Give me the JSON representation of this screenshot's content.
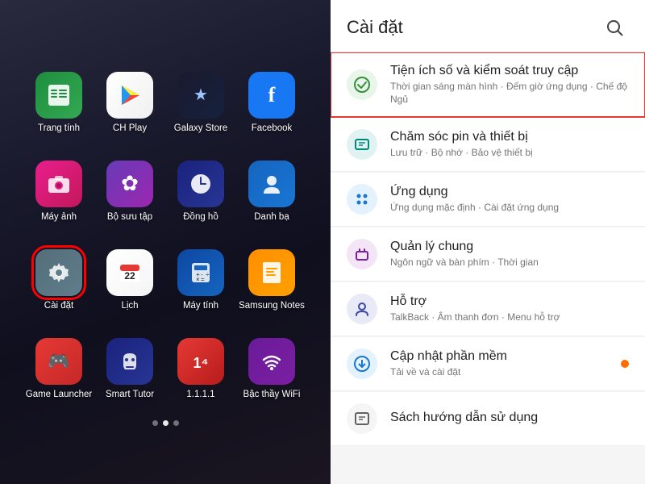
{
  "left_panel": {
    "apps": [
      {
        "id": "sheets",
        "label": "Trang tính",
        "icon_class": "icon-sheets",
        "icon_symbol": "📊",
        "highlighted": false
      },
      {
        "id": "chplay",
        "label": "CH Play",
        "icon_class": "icon-chplay",
        "icon_symbol": "▶",
        "highlighted": false
      },
      {
        "id": "galaxy-store",
        "label": "Galaxy Store",
        "icon_class": "icon-galaxy",
        "icon_symbol": "★",
        "highlighted": false
      },
      {
        "id": "facebook",
        "label": "Facebook",
        "icon_class": "icon-facebook",
        "icon_symbol": "f",
        "highlighted": false
      },
      {
        "id": "camera",
        "label": "Máy ảnh",
        "icon_class": "icon-camera",
        "icon_symbol": "📷",
        "highlighted": false
      },
      {
        "id": "collection",
        "label": "Bộ sưu tập",
        "icon_class": "icon-bst",
        "icon_symbol": "✿",
        "highlighted": false
      },
      {
        "id": "clock",
        "label": "Đồng hồ",
        "icon_class": "icon-clock",
        "icon_symbol": "🕐",
        "highlighted": false
      },
      {
        "id": "contacts",
        "label": "Danh bạ",
        "icon_class": "icon-contacts",
        "icon_symbol": "👤",
        "highlighted": false
      },
      {
        "id": "settings",
        "label": "Cài đặt",
        "icon_class": "icon-settings",
        "icon_symbol": "⚙",
        "highlighted": true
      },
      {
        "id": "calendar",
        "label": "Lịch",
        "icon_class": "icon-calendar",
        "icon_symbol": "📅",
        "highlighted": false
      },
      {
        "id": "calculator",
        "label": "Máy tính",
        "icon_class": "icon-calculator",
        "icon_symbol": "±",
        "highlighted": false
      },
      {
        "id": "samsung-notes",
        "label": "Samsung\nNotes",
        "icon_class": "icon-samsung-notes",
        "icon_symbol": "📝",
        "highlighted": false
      },
      {
        "id": "game-launcher",
        "label": "Game\nLauncher",
        "icon_class": "icon-game",
        "icon_symbol": "🎮",
        "highlighted": false
      },
      {
        "id": "smart-tutor",
        "label": "Smart Tutor",
        "icon_class": "icon-smart-tutor",
        "icon_symbol": "🎧",
        "highlighted": false
      },
      {
        "id": "111",
        "label": "1.1.1.1",
        "icon_class": "icon-111",
        "icon_symbol": "1",
        "highlighted": false
      },
      {
        "id": "wifi-master",
        "label": "Bậc thầy WiFi",
        "icon_class": "icon-wifi",
        "icon_symbol": "📶",
        "highlighted": false
      }
    ],
    "dots": [
      {
        "active": false
      },
      {
        "active": true
      },
      {
        "active": false
      }
    ]
  },
  "right_panel": {
    "header": {
      "title": "Cài đặt",
      "search_icon": "🔍"
    },
    "items": [
      {
        "id": "digital-wellbeing",
        "title": "Tiện ích số và kiểm soát truy cập",
        "subtitle": "Thời gian sáng màn hình · Đếm giờ ứng dụng · Chế độ Ngủ",
        "icon_type": "green",
        "highlighted": true,
        "badge": false
      },
      {
        "id": "battery-device",
        "title": "Chăm sóc pin và thiết bị",
        "subtitle": "Lưu trữ · Bộ nhớ · Bảo vệ thiết bị",
        "icon_type": "teal",
        "highlighted": false,
        "badge": false
      },
      {
        "id": "apps",
        "title": "Ứng dụng",
        "subtitle": "Ứng dụng mặc định · Cài đặt ứng dụng",
        "icon_type": "blue-grid",
        "highlighted": false,
        "badge": false
      },
      {
        "id": "general",
        "title": "Quản lý chung",
        "subtitle": "Ngôn ngữ và bàn phím · Thời gian",
        "icon_type": "purple",
        "highlighted": false,
        "badge": false
      },
      {
        "id": "support",
        "title": "Hỗ trợ",
        "subtitle": "TalkBack · Âm thanh đơn · Menu hỗ trợ",
        "icon_type": "blue-person",
        "highlighted": false,
        "badge": false
      },
      {
        "id": "software-update",
        "title": "Cập nhật phần mềm",
        "subtitle": "Tải về và cài đặt",
        "icon_type": "blue-dl",
        "highlighted": false,
        "badge": true
      },
      {
        "id": "user-manual",
        "title": "Sách hướng dẫn sử dụng",
        "subtitle": "",
        "icon_type": "gray",
        "highlighted": false,
        "badge": false
      }
    ]
  }
}
